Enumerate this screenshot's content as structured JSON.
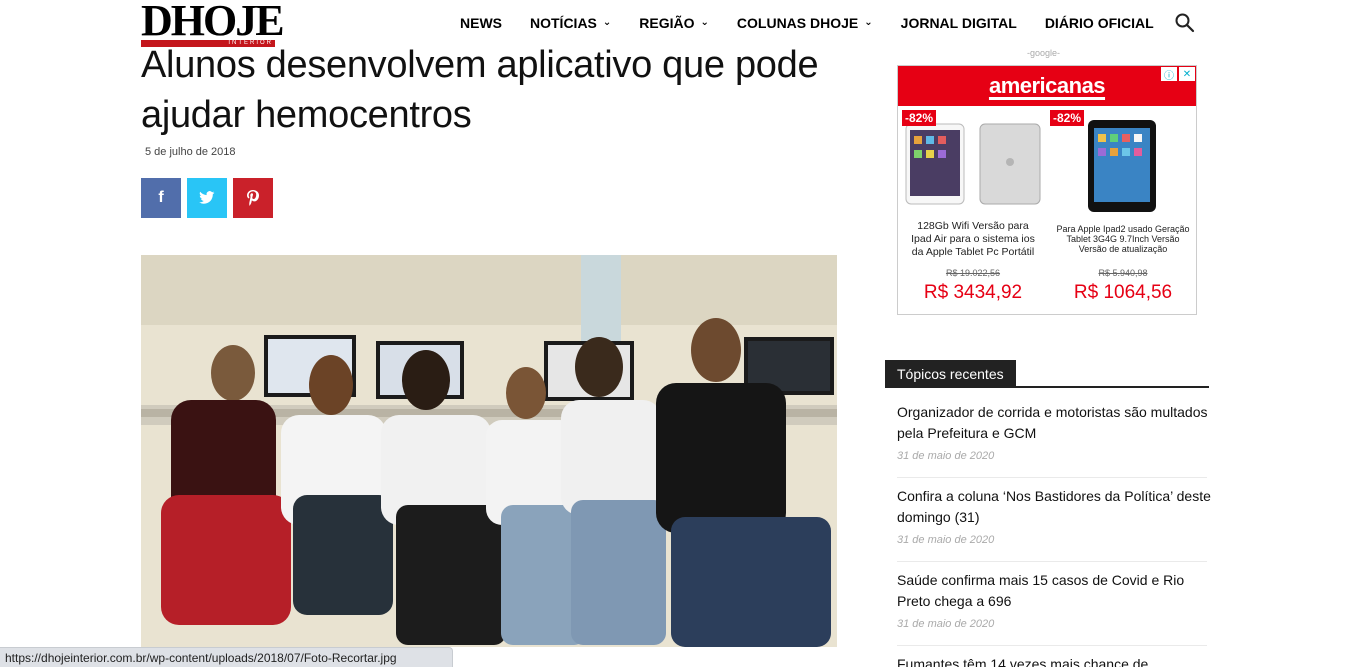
{
  "header": {
    "logo_text": "DHOJE",
    "logo_sub": "INTERIOR",
    "nav": [
      {
        "label": "NEWS",
        "dropdown": false
      },
      {
        "label": "NOTÍCIAS",
        "dropdown": true
      },
      {
        "label": "REGIÃO",
        "dropdown": true
      },
      {
        "label": "COLUNAS DHOJE",
        "dropdown": true
      },
      {
        "label": "JORNAL DIGITAL",
        "dropdown": false
      },
      {
        "label": "DIÁRIO OFICIAL",
        "dropdown": false
      }
    ],
    "search_icon": "search-icon"
  },
  "article": {
    "title": "Alunos desenvolvem aplicativo que pode ajudar hemocentros",
    "date": "5 de julho de 2018",
    "share": {
      "facebook_glyph": "f",
      "twitter_glyph": "t",
      "pinterest_glyph": "p"
    },
    "colors": {
      "facebook": "#516eab",
      "twitter": "#29c5f6",
      "pinterest": "#ca212a"
    }
  },
  "ad": {
    "label": "-google-",
    "brand": "americanas",
    "brand_color": "#e60014",
    "products": [
      {
        "discount": "-82%",
        "description": "128Gb Wifi Versão para Ipad Air para o sistema ios da Apple Tablet Pc Portátil",
        "old_price": "R$ 19.022,56",
        "price": "R$ 3434,92"
      },
      {
        "discount": "-82%",
        "description": "Para Apple Ipad2 usado Geração Tablet 3G4G 9.7Inch Versão Versão de atualização",
        "old_price": "R$ 5.940,98",
        "price": "R$ 1064,56"
      }
    ]
  },
  "recent": {
    "header": "Tópicos recentes",
    "items": [
      {
        "title": "Organizador de corrida e motoristas são multados pela Prefeitura e GCM",
        "date": "31 de maio de 2020"
      },
      {
        "title": "Confira a coluna ‘Nos Bastidores da Política’ deste domingo (31)",
        "date": "31 de maio de 2020"
      },
      {
        "title": "Saúde confirma mais 15 casos de Covid e Rio Preto chega a 696",
        "date": "31 de maio de 2020"
      },
      {
        "title": "Fumantes têm 14 vezes mais chance de"
      }
    ]
  },
  "status_bar": {
    "url": "https://dhojeinterior.com.br/wp-content/uploads/2018/07/Foto-Recortar.jpg"
  }
}
